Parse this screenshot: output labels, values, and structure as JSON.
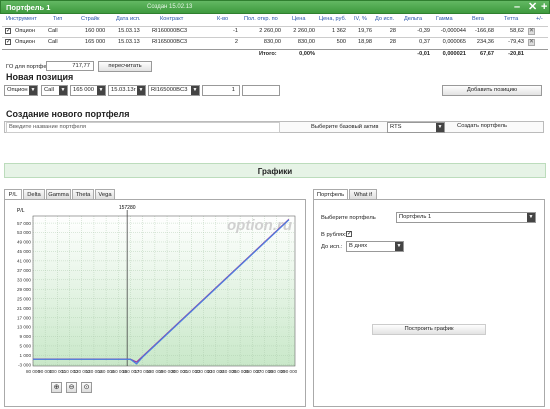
{
  "header": {
    "title": "Портфель 1",
    "created": "Создан 15.02.13",
    "btn_min": "–",
    "btn_close": "✕",
    "btn_add": "+"
  },
  "table": {
    "columns": [
      "Инструмент",
      "Тип",
      "Страйк",
      "Дата исп.",
      "Контракт",
      "К-во",
      "Пол. откр. по",
      "Цена",
      "Цена, руб.",
      "IV, %",
      "До исп.",
      "Дельта",
      "Гамма",
      "Вега",
      "Тетта",
      "+/-"
    ],
    "rows": [
      {
        "instrument": "Опцион",
        "type": "Call",
        "strike": "160 000",
        "date": "15.03.13",
        "contract": "RI160000BC3",
        "qty": "-1",
        "open": "2 260,00",
        "price": "2 260,00",
        "price_rub": "1 362",
        "iv": "19,76",
        "days": "28",
        "delta": "-0,39",
        "gamma": "-0,000044",
        "vega": "-166,68",
        "theta": "58,62"
      },
      {
        "instrument": "Опцион",
        "type": "Call",
        "strike": "165 000",
        "date": "15.03.13",
        "contract": "RI165000BC3",
        "qty": "2",
        "open": "830,00",
        "price": "830,00",
        "price_rub": "500",
        "iv": "18,98",
        "days": "28",
        "delta": "0,37",
        "gamma": "0,000065",
        "vega": "234,36",
        "theta": "-79,43"
      }
    ],
    "total": {
      "label": "Итого:",
      "pct": "0,00%",
      "delta": "-0,01",
      "gamma": "0,000021",
      "vega": "67,67",
      "theta": "-20,81"
    }
  },
  "go": {
    "label": "ГО для портфеля:",
    "value": "717,77",
    "recalc": "пересчитать"
  },
  "new_position": {
    "heading": "Новая позиция",
    "instrument": "Опцион",
    "type": "Call",
    "strike": "165 000",
    "date": "15.03.13г",
    "contract": "RI165000BC3",
    "qty": "1",
    "add_button": "Добавить позицию"
  },
  "new_portfolio": {
    "heading": "Создание нового портфеля",
    "name_placeholder": "Введите название портфеля",
    "asset_label": "Выберите базовый актив",
    "asset_value": "RTS",
    "create_button": "Создать портфель"
  },
  "graphs": {
    "title": "Графики",
    "tabs": [
      "P/L",
      "Delta",
      "Gamma",
      "Theta",
      "Vega"
    ],
    "watermark": "option.ru",
    "marker_label": "157280"
  },
  "right_panel": {
    "tabs": [
      "Портфель",
      "What if"
    ],
    "portfolio_label": "Выберите портфель",
    "portfolio_value": "Портфель 1",
    "rub_label": "В рублях:",
    "rub_checked": "✓",
    "expiry_label": "До исп.:",
    "expiry_value": "В днях",
    "build_button": "Построить график"
  },
  "chart_data": {
    "type": "line",
    "ylabel": "P/L",
    "x_ticks": [
      "80 000",
      "90 000",
      "100 000",
      "110 000",
      "120 000",
      "130 000",
      "140 000",
      "150 000",
      "160 000",
      "170 000",
      "180 000",
      "190 000",
      "200 000",
      "210 000",
      "220 000",
      "230 000",
      "240 000",
      "250 000",
      "260 000",
      "270 000",
      "280 000",
      "290 000"
    ],
    "y_ticks": [
      "57 000",
      "53 000",
      "49 000",
      "45 000",
      "41 000",
      "37 000",
      "33 000",
      "29 000",
      "25 000",
      "21 000",
      "17 000",
      "13 000",
      "9 000",
      "5 000",
      "1 000",
      "-3 000"
    ],
    "xlim": [
      80000,
      295000
    ],
    "ylim": [
      -3500,
      60000
    ],
    "marker_x": 157280,
    "series": [
      {
        "color": "#9a3aa0",
        "x": [
          80000,
          155000,
          160000,
          165000,
          170000,
          290000
        ],
        "y": [
          -600,
          -600,
          -620,
          -1800,
          600,
          58600
        ]
      },
      {
        "color": "#4a80e0",
        "x": [
          80000,
          155000,
          160000,
          165000,
          170000,
          290000
        ],
        "y": [
          -650,
          -650,
          -700,
          -2600,
          300,
          58400
        ]
      }
    ]
  }
}
